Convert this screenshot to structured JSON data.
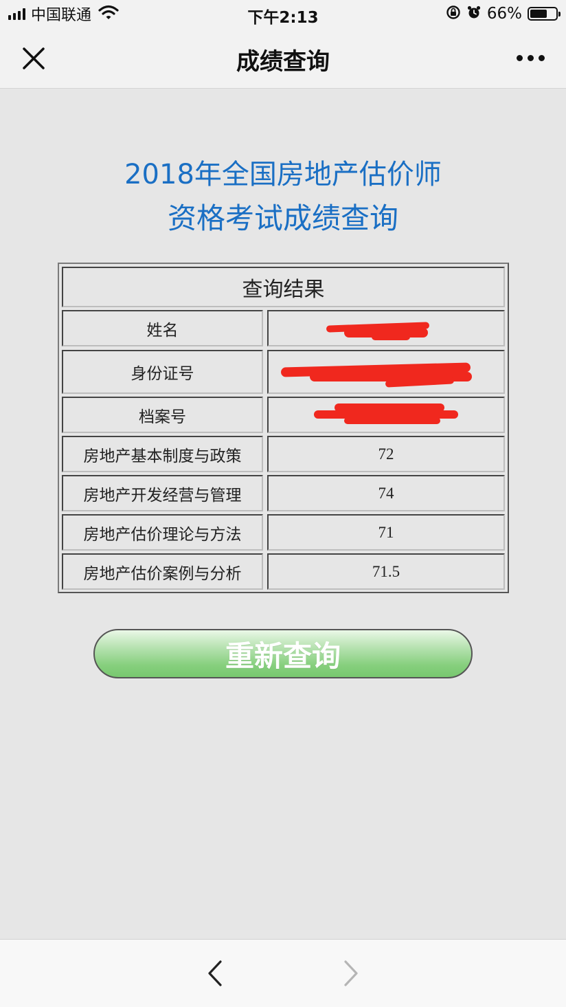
{
  "status_bar": {
    "carrier": "中国联通",
    "time": "下午2:13",
    "battery_percent": "66%",
    "battery_level": 0.66,
    "icons": [
      "signal-icon",
      "wifi-icon",
      "orientation-lock-icon",
      "alarm-icon",
      "battery-icon"
    ]
  },
  "nav": {
    "title": "成绩查询",
    "close_icon": "close-icon",
    "more_icon": "more-icon"
  },
  "heading": {
    "line1": "2018年全国房地产估价师",
    "line2": "资格考试成绩查询",
    "color": "#1a6fc4"
  },
  "result": {
    "title": "查询结果",
    "rows": [
      {
        "label": "姓名",
        "value": ""
      },
      {
        "label": "身份证号",
        "value": ""
      },
      {
        "label": "档案号",
        "value": ""
      },
      {
        "label": "房地产基本制度与政策",
        "value": "72"
      },
      {
        "label": "房地产开发经营与管理",
        "value": "74"
      },
      {
        "label": "房地产估价理论与方法",
        "value": "71"
      },
      {
        "label": "房地产估价案例与分析",
        "value": "71.5"
      }
    ],
    "redaction_color": "#f0281e"
  },
  "buttons": {
    "requery_label": "重新查询"
  },
  "toolbar": {
    "back_icon": "chevron-left-icon",
    "forward_icon": "chevron-right-icon"
  }
}
